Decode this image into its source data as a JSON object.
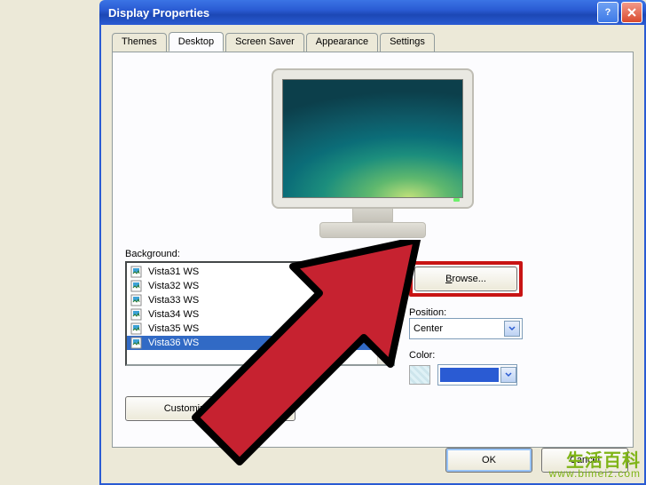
{
  "window": {
    "title": "Display Properties"
  },
  "tabs": {
    "items": [
      "Themes",
      "Desktop",
      "Screen Saver",
      "Appearance",
      "Settings"
    ],
    "active": 1
  },
  "background": {
    "label": "Background:",
    "items": [
      "Vista31 WS",
      "Vista32 WS",
      "Vista33 WS",
      "Vista34 WS",
      "Vista35 WS",
      "Vista36 WS"
    ],
    "selected_index": 5
  },
  "buttons": {
    "browse": "Browse...",
    "customize": "Customize Desktop...",
    "ok": "OK",
    "cancel": "Cancel"
  },
  "position": {
    "label": "Position:",
    "value": "Center"
  },
  "color": {
    "label": "Color:",
    "value": "#2a5bd3"
  },
  "watermark": {
    "line1": "生活百科",
    "line2": "www.bimeiz.com"
  }
}
